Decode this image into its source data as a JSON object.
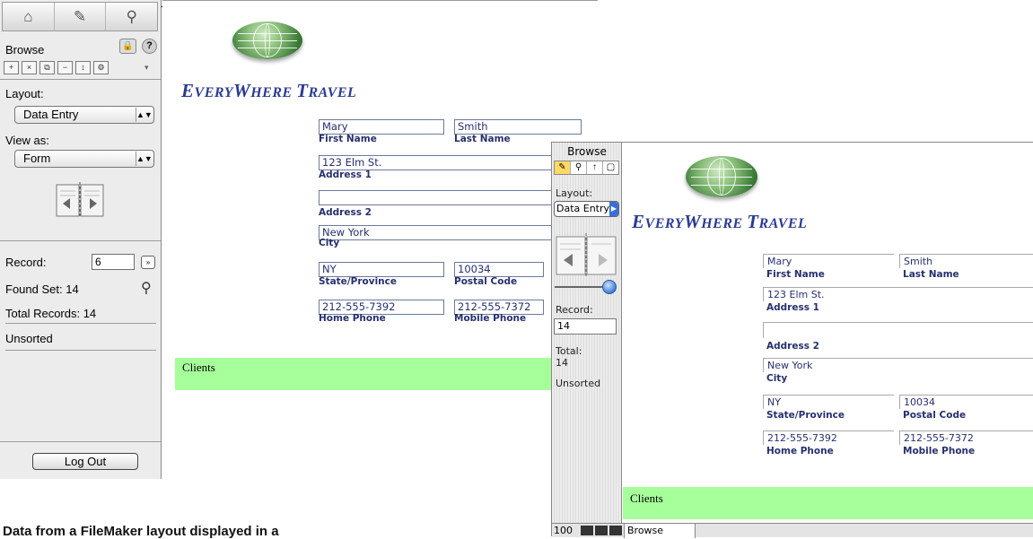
{
  "left_window": {
    "sidebar": {
      "mode_label": "Browse",
      "layout_label": "Layout:",
      "layout_value": "Data Entry",
      "view_as_label": "View as:",
      "view_as_value": "Form",
      "record_label": "Record:",
      "record_value": "6",
      "found_set": "Found Set: 14",
      "total_records": "Total Records: 14",
      "sort_status": "Unsorted",
      "logout_label": "Log Out"
    },
    "layout": {
      "brand_part1_cap": "E",
      "brand_part1_rest": "VERY",
      "brand_part2_cap": "W",
      "brand_part2_rest": "HERE",
      "brand_part3_cap": "T",
      "brand_part3_rest": "RAVEL",
      "fields": {
        "first_name": {
          "value": "Mary",
          "label": "First Name"
        },
        "last_name": {
          "value": "Smith",
          "label": "Last Name"
        },
        "address1": {
          "value": "123 Elm St.",
          "label": "Address 1"
        },
        "address2": {
          "value": "",
          "label": "Address 2"
        },
        "city": {
          "value": "New York",
          "label": "City"
        },
        "state": {
          "value": "NY",
          "label": "State/Province"
        },
        "postal": {
          "value": "10034",
          "label": "Postal Code"
        },
        "home_phone": {
          "value": "212-555-7392",
          "label": "Home Phone"
        },
        "mobile_phone": {
          "value": "212-555-7372",
          "label": "Mobile Phone"
        }
      },
      "footer_label": "Clients"
    }
  },
  "right_window": {
    "sidebar": {
      "mode_label": "Browse",
      "layout_label": "Layout:",
      "layout_value": "Data Entry",
      "record_label": "Record:",
      "record_value": "14",
      "total_label": "Total:",
      "total_value": "14",
      "sort_status": "Unsorted"
    },
    "bottom_bar": {
      "zoom": "100",
      "mode": "Browse"
    },
    "layout": {
      "footer_label": "Clients"
    }
  },
  "caption": "Data from a FileMaker layout displayed in a"
}
